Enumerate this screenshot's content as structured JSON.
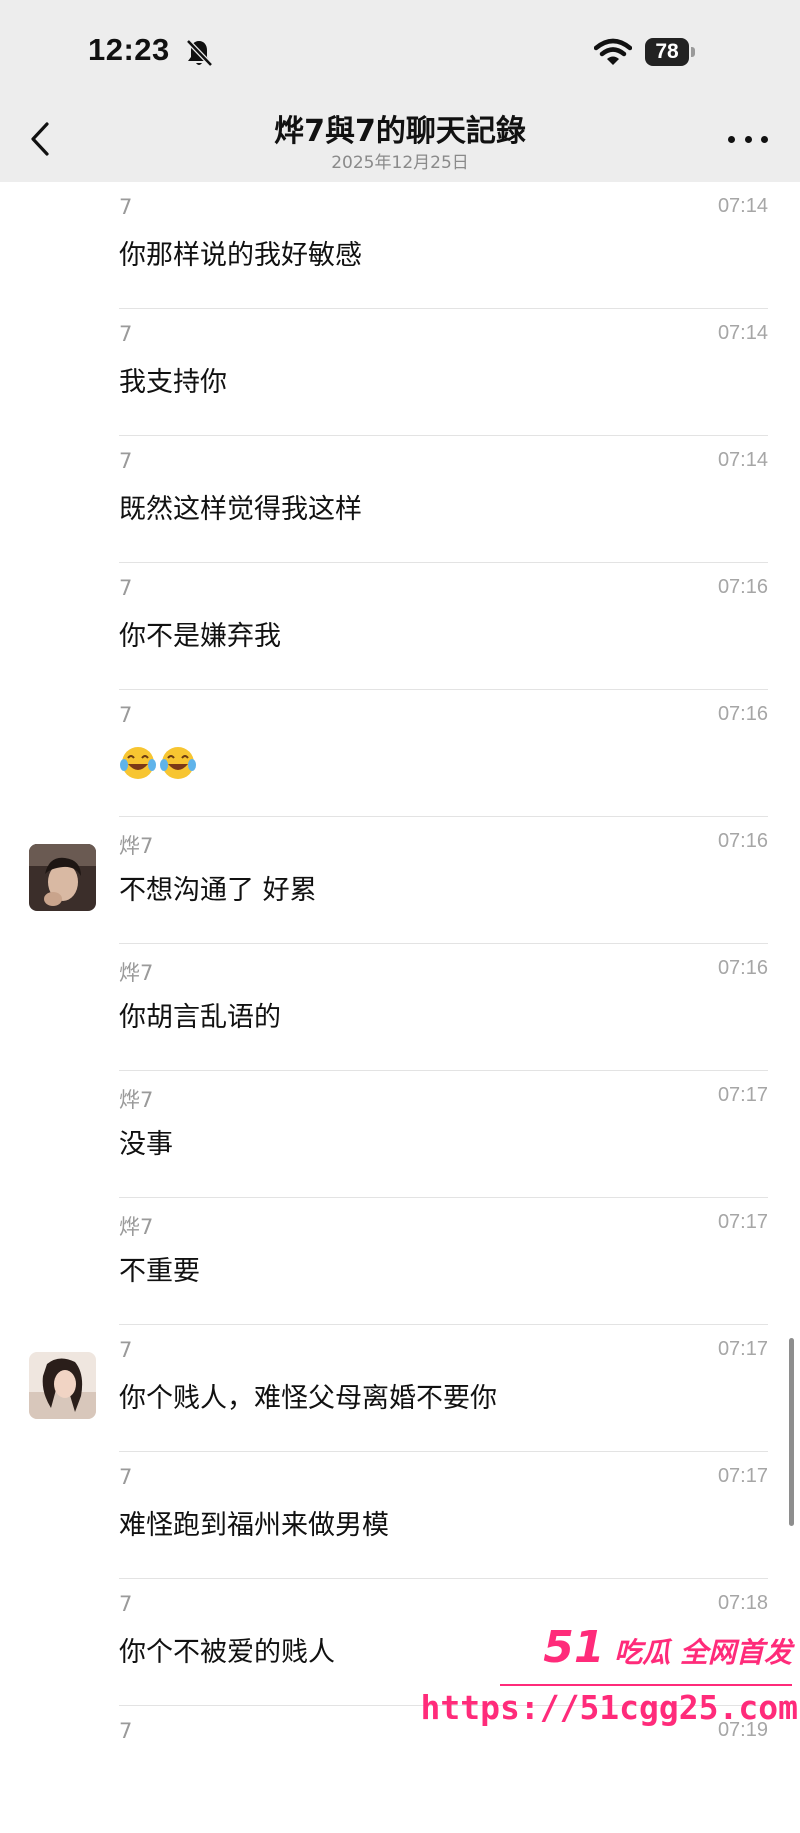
{
  "status_bar": {
    "time": "12:23",
    "battery": "78"
  },
  "header": {
    "title": "烨7與7的聊天記錄",
    "date": "2025年12月25日"
  },
  "messages": [
    {
      "sender": "7",
      "time": "07:14",
      "text": "你那样说的我好敏感"
    },
    {
      "sender": "7",
      "time": "07:14",
      "text": "我支持你"
    },
    {
      "sender": "7",
      "time": "07:14",
      "text": "既然这样觉得我这样"
    },
    {
      "sender": "7",
      "time": "07:16",
      "text": "你不是嫌弃我"
    },
    {
      "sender": "7",
      "time": "07:16",
      "text": "",
      "emoji_count": 2
    },
    {
      "sender": "烨7",
      "time": "07:16",
      "text": "不想沟通了 好累"
    },
    {
      "sender": "烨7",
      "time": "07:16",
      "text": "你胡言乱语的"
    },
    {
      "sender": "烨7",
      "time": "07:17",
      "text": "没事"
    },
    {
      "sender": "烨7",
      "time": "07:17",
      "text": "不重要"
    },
    {
      "sender": "7",
      "time": "07:17",
      "text": "你个贱人，难怪父母离婚不要你"
    },
    {
      "sender": "7",
      "time": "07:17",
      "text": "难怪跑到福州来做男模"
    },
    {
      "sender": "7",
      "time": "07:18",
      "text": "你个不被爱的贱人"
    },
    {
      "sender": "7",
      "time": "07:19",
      "text": ""
    }
  ],
  "watermark": {
    "num": "51",
    "brand": "吃瓜 全网首发",
    "url": "https://51cgg25.com"
  },
  "icons": {
    "mute": "bell-slash-icon",
    "wifi": "wifi-icon",
    "back": "chevron-left-icon",
    "more": "more-icon",
    "emoji": "tears-of-joy-emoji"
  }
}
